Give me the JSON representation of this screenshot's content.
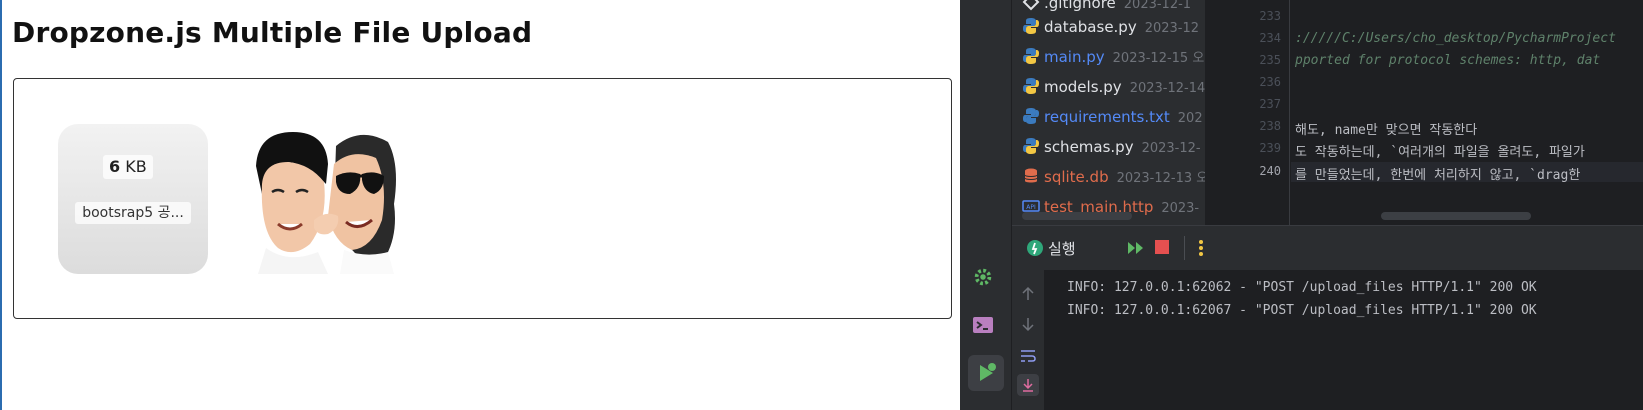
{
  "page": {
    "title": "Dropzone.js Multiple File Upload"
  },
  "dropzone": {
    "file1": {
      "size_number": "6",
      "size_unit": "KB",
      "name": "bootsrap5 공..."
    }
  },
  "ide": {
    "project_files": [
      {
        "name": ".gitignore",
        "date": "2023-12-1",
        "color": "#dfe1e5",
        "icon": "git-diamond-icon"
      },
      {
        "name": "database.py",
        "date": "2023-12",
        "color": "#dfe1e5",
        "icon": "python-icon"
      },
      {
        "name": "main.py",
        "date": "2023-12-15 오",
        "color": "#548af7",
        "icon": "python-icon"
      },
      {
        "name": "models.py",
        "date": "2023-12-14",
        "color": "#dfe1e5",
        "icon": "python-icon"
      },
      {
        "name": "requirements.txt",
        "date": "202",
        "color": "#548af7",
        "icon": "python-requirements-icon"
      },
      {
        "name": "schemas.py",
        "date": "2023-12-",
        "color": "#dfe1e5",
        "icon": "python-icon"
      },
      {
        "name": "sqlite.db",
        "date": "2023-12-13 오",
        "color": "#e06c4c",
        "icon": "database-icon"
      },
      {
        "name": "test_main.http",
        "date": "2023-",
        "color": "#e06c4c",
        "icon": "api-icon"
      }
    ],
    "line_numbers": [
      "233",
      "234",
      "235",
      "236",
      "237",
      "238",
      "239",
      "240"
    ],
    "code_lines": [
      "",
      "://///C:/Users/cho_desktop/PycharmProject",
      "pported for protocol schemes: http, dat",
      "",
      "",
      "해도, name만 맞으면 작동한다",
      "도 작동하는데, `여러개의 파일을 올려도, 파일가",
      "를 만들었는데, 한번에 처리하지 않고, `drag한"
    ],
    "run_label": "실행",
    "console_lines": [
      "INFO:     127.0.0.1:62062 - \"POST /upload_files HTTP/1.1\" 200 OK",
      "INFO:     127.0.0.1:62067 - \"POST /upload_files HTTP/1.1\" 200 OK"
    ]
  }
}
